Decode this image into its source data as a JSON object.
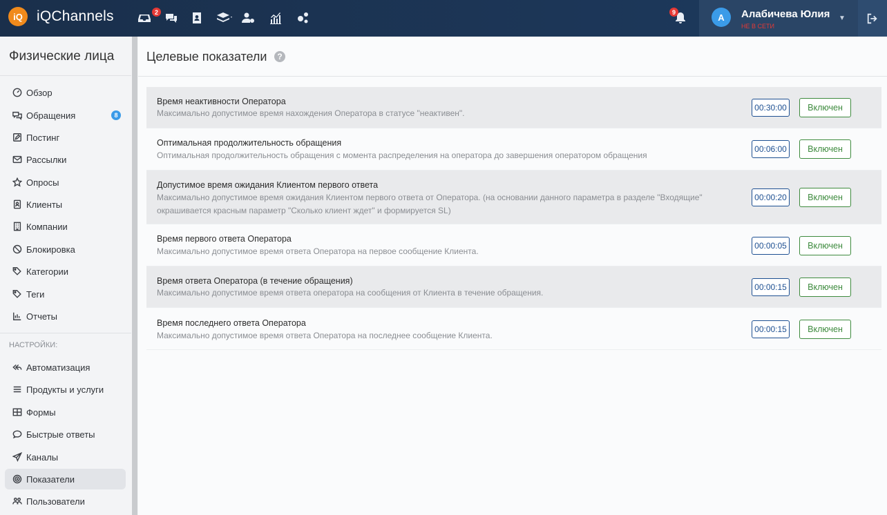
{
  "header": {
    "logo_badge": "iQ",
    "app_name": "iQChannels",
    "inbox_badge": "2",
    "bell_badge": "9",
    "user": {
      "avatar_letter": "А",
      "name": "Алабичева Юлия",
      "status": "не в сети"
    },
    "nav_icons": [
      "inbox-icon",
      "chats-icon",
      "contacts-icon",
      "layers-icon",
      "user-settings-icon",
      "analytics-icon",
      "cogs-icon"
    ]
  },
  "sidebar": {
    "title": "Физические лица",
    "items": [
      {
        "label": "Обзор",
        "icon": "dashboard-icon"
      },
      {
        "label": "Обращения",
        "icon": "chats-icon",
        "count": "8"
      },
      {
        "label": "Постинг",
        "icon": "edit-icon"
      },
      {
        "label": "Рассылки",
        "icon": "mail-icon"
      },
      {
        "label": "Опросы",
        "icon": "star-icon"
      },
      {
        "label": "Клиенты",
        "icon": "contact-card-icon"
      },
      {
        "label": "Компании",
        "icon": "building-icon"
      },
      {
        "label": "Блокировка",
        "icon": "ban-icon"
      },
      {
        "label": "Категории",
        "icon": "tags-icon"
      },
      {
        "label": "Теги",
        "icon": "tag-icon"
      },
      {
        "label": "Отчеты",
        "icon": "bar-chart-icon"
      }
    ],
    "settings_title": "НАСТРОЙКИ:",
    "settings_items": [
      {
        "label": "Автоматизация",
        "icon": "reply-all-icon"
      },
      {
        "label": "Продукты и услуги",
        "icon": "list-icon"
      },
      {
        "label": "Формы",
        "icon": "table-icon"
      },
      {
        "label": "Быстрые ответы",
        "icon": "comment-dots-icon"
      },
      {
        "label": "Каналы",
        "icon": "paper-plane-icon"
      },
      {
        "label": "Показатели",
        "icon": "target-icon",
        "active": true
      },
      {
        "label": "Пользователи",
        "icon": "users-icon"
      }
    ]
  },
  "main": {
    "title": "Целевые показатели",
    "help": "?",
    "rows": [
      {
        "title": "Время неактивности Оператора",
        "desc": "Максимально допустимое время нахождения Оператора в статусе \"неактивен\".",
        "time": "00:30:00",
        "status": "Включен"
      },
      {
        "title": "Оптимальная продолжительность обращения",
        "desc": "Оптимальная продолжительность обращения с момента распределения на оператора до завершения оператором обращения",
        "time": "00:06:00",
        "status": "Включен"
      },
      {
        "title": "Допустимое время ожидания Клиентом первого ответа",
        "desc": "Максимально допустимое время ожидания Клиентом первого ответа от Оператора. (на основании данного параметра в разделе \"Входящие\" окрашивается красным параметр \"Сколько клиент ждет\" и формируется SL)",
        "time": "00:00:20",
        "status": "Включен"
      },
      {
        "title": "Время первого ответа Оператора",
        "desc": "Максимально допустимое время ответа Оператора на первое сообщение Клиента.",
        "time": "00:00:05",
        "status": "Включен"
      },
      {
        "title": "Время ответа Оператора (в течение обращения)",
        "desc": "Максимально допустимое время ответа оператора на сообщения от Клиента в течение обращения.",
        "time": "00:00:15",
        "status": "Включен"
      },
      {
        "title": "Время последнего ответа Оператора",
        "desc": "Максимально допустимое время ответа Оператора на последнее сообщение Клиента.",
        "time": "00:00:15",
        "status": "Включен"
      }
    ]
  },
  "colors": {
    "header_bg": "#1d3a5e",
    "accent_blue": "#3b9be8",
    "time_border": "#1d4f91",
    "enabled_green": "#3d8a3d",
    "badge_red": "#e53935"
  }
}
